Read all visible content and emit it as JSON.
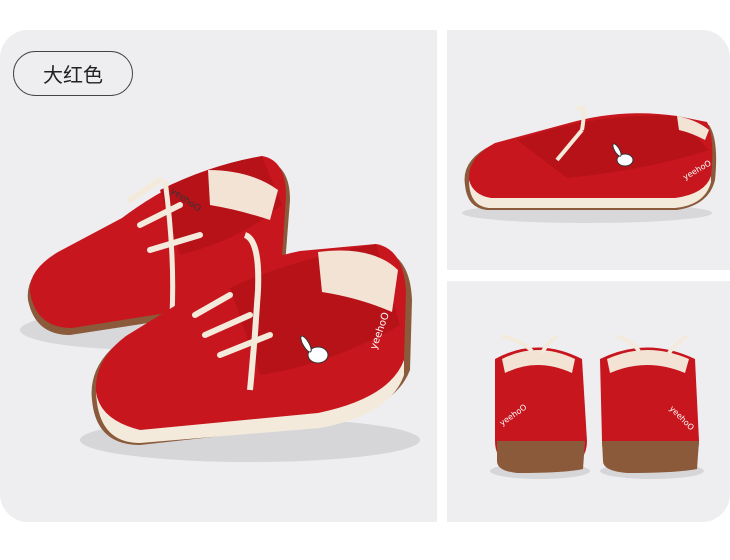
{
  "color_chip": {
    "label": "大红色"
  },
  "brand_mark": "yeehoO",
  "colors": {
    "shoe_red": "#c8161e",
    "fleece_red": "#b81219",
    "sole": "#8a5a3a",
    "lace": "#f3eadc",
    "panel_bg": "#eeeef0"
  },
  "images": [
    {
      "view": "pair-three-quarter"
    },
    {
      "view": "single-side"
    },
    {
      "view": "pair-back"
    }
  ]
}
